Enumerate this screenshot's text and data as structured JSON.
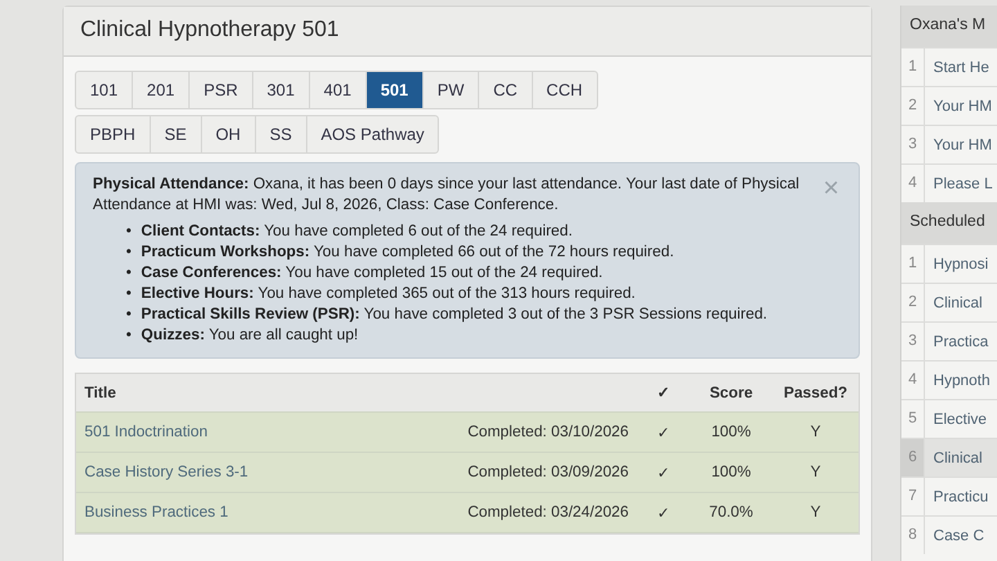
{
  "panel": {
    "title": "Clinical Hypnotherapy 501"
  },
  "tabs": [
    [
      {
        "label": "101",
        "selected": false
      },
      {
        "label": "201",
        "selected": false
      },
      {
        "label": "PSR",
        "selected": false
      },
      {
        "label": "301",
        "selected": false
      },
      {
        "label": "401",
        "selected": false
      },
      {
        "label": "501",
        "selected": true
      },
      {
        "label": "PW",
        "selected": false
      },
      {
        "label": "CC",
        "selected": false
      },
      {
        "label": "CCH",
        "selected": false
      }
    ],
    [
      {
        "label": "PBPH",
        "selected": false
      },
      {
        "label": "SE",
        "selected": false
      },
      {
        "label": "OH",
        "selected": false
      },
      {
        "label": "SS",
        "selected": false
      },
      {
        "label": "AOS Pathway",
        "selected": false
      }
    ]
  ],
  "alert": {
    "text": "**Physical Attendance:** Oxana, it has been 0 days since your last attendance. Your last date of Physical Attendance at HMI was: Wed, Jul 8, 2026, Class: Case Conference.",
    "close": "×",
    "items": [
      {
        "bullet": "•",
        "text": "**Client Contacts:** You have completed 6 out of the 24 required."
      },
      {
        "bullet": "•",
        "text": "**Practicum Workshops:** You have completed 66 out of the 72 hours required."
      },
      {
        "bullet": "•",
        "text": "**Case Conferences:** You have completed 15 out of the 24 required."
      },
      {
        "bullet": "•",
        "text": "**Elective Hours:** You have completed 365 out of the 313 hours required."
      },
      {
        "bullet": "•",
        "text": "**Practical Skills Review (PSR):** You have completed 3 out of the 3 PSR Sessions required."
      },
      {
        "bullet": "•",
        "text": "**Quizzes:** You are all caught up!"
      }
    ]
  },
  "table": {
    "columns": [
      "Title",
      "✓",
      "Score",
      "Passed?"
    ],
    "rows": [
      {
        "title": "501 Indoctrination",
        "status": "Completed: 03/10/2026",
        "check": "✓",
        "score": "100%",
        "passed": "Y"
      },
      {
        "title": "Case History Series 3-1",
        "status": "Completed: 03/09/2026",
        "check": "✓",
        "score": "100%",
        "passed": "Y"
      },
      {
        "title": "Business Practices 1",
        "status": "Completed: 03/24/2026",
        "check": "✓",
        "score": "70.0%",
        "passed": "Y"
      }
    ]
  },
  "sidebar": [
    {
      "heading": "Oxana's M",
      "items": [
        {
          "number": "1",
          "label": "Start He",
          "selected": false
        },
        {
          "number": "2",
          "label": "Your HM",
          "selected": false
        },
        {
          "number": "3",
          "label": "Your HM",
          "selected": false
        },
        {
          "number": "4",
          "label": "Please L",
          "selected": false
        }
      ]
    },
    {
      "heading": "Scheduled",
      "items": [
        {
          "number": "1",
          "label": "Hypnosi",
          "selected": false
        },
        {
          "number": "2",
          "label": "Clinical",
          "selected": false
        },
        {
          "number": "3",
          "label": "Practica",
          "selected": false
        },
        {
          "number": "4",
          "label": "Hypnoth",
          "selected": false
        },
        {
          "number": "5",
          "label": "Elective",
          "selected": false
        },
        {
          "number": "6",
          "label": "Clinical",
          "selected": true
        },
        {
          "number": "7",
          "label": "Practicu",
          "selected": false
        },
        {
          "number": "8",
          "label": "Case C",
          "selected": false
        }
      ]
    }
  ]
}
